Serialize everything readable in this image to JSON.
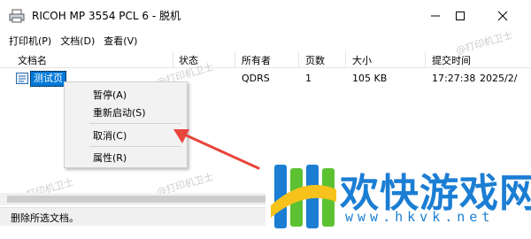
{
  "window": {
    "title": "RICOH MP 3554 PCL 6 - 脱机",
    "menu": [
      "打印机(P)",
      "文档(D)",
      "查看(V)"
    ]
  },
  "table": {
    "columns": [
      "文档名",
      "状态",
      "所有者",
      "页数",
      "大小",
      "提交时间"
    ],
    "rows": [
      {
        "name": "测试页",
        "status": "",
        "owner": "QDRS",
        "pages": "1",
        "size": "105 KB",
        "time": "17:27:38",
        "date": "2025/2/"
      }
    ]
  },
  "context_menu": {
    "items": [
      "暂停(A)",
      "重新启动(S)",
      "取消(C)",
      "属性(R)"
    ]
  },
  "status_bar": {
    "text": "删除所选文档。"
  },
  "watermark": {
    "text": "@打印机卫士"
  },
  "logo": {
    "name": "欢快游戏网",
    "url": "www.hkvk.net"
  },
  "colors": {
    "selection": "#0078d7",
    "arrow": "#e8453c",
    "logo_blue": "#1b7ed3",
    "logo_green": "#5cc231",
    "logo_yellow": "#f7c21c"
  }
}
